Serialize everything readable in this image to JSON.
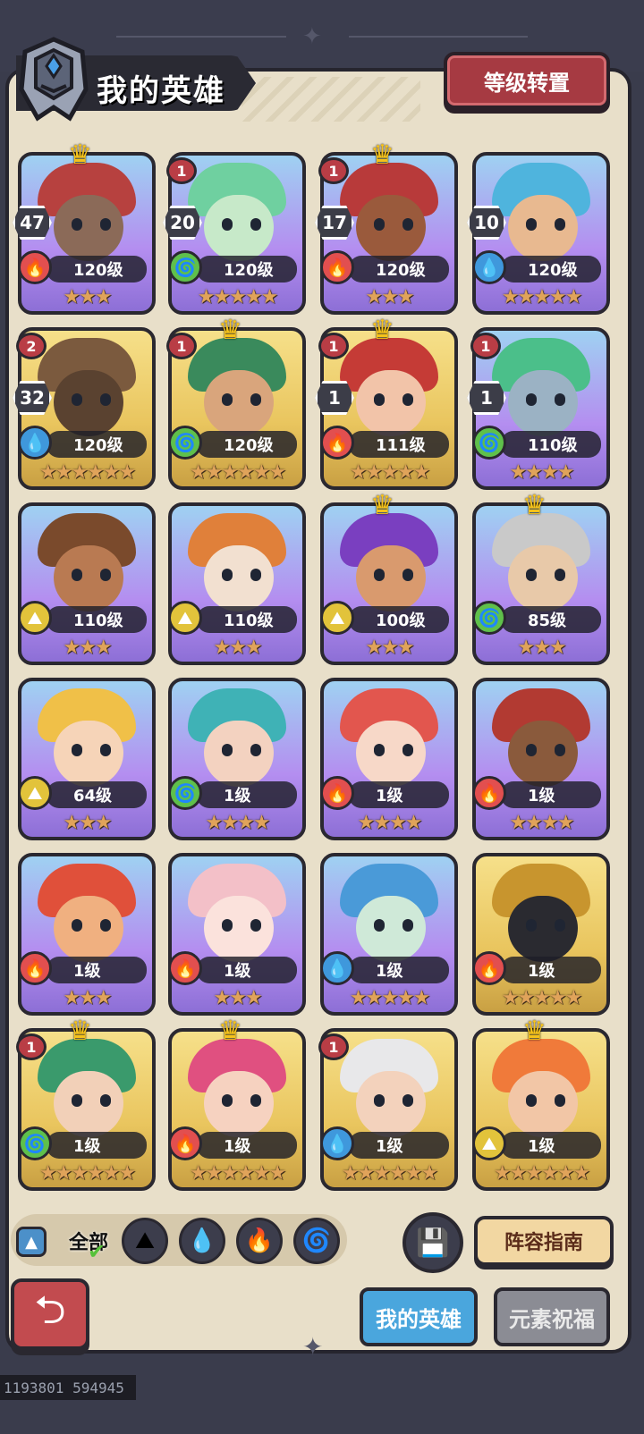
{
  "header": {
    "title": "我的英雄",
    "transfer_button": "等级转置"
  },
  "heroes": [
    {
      "level": "120级",
      "element": "fire",
      "stars": "★★★",
      "frame": "purple",
      "crown": true,
      "badge_top": "",
      "badge_count": "47",
      "hair": "#b7413f",
      "skin": "#8b6a58"
    },
    {
      "level": "120级",
      "element": "wind",
      "stars": "★★★★★",
      "frame": "purple",
      "crown": false,
      "badge_top": "1",
      "badge_count": "20",
      "hair": "#6fd0a0",
      "skin": "#c7e9c9"
    },
    {
      "level": "120级",
      "element": "fire",
      "stars": "★★★",
      "frame": "purple",
      "crown": true,
      "badge_top": "1",
      "badge_count": "17",
      "hair": "#b83a3a",
      "skin": "#9a5a3c"
    },
    {
      "level": "120级",
      "element": "water",
      "stars": "★★★★★",
      "frame": "purple",
      "crown": false,
      "badge_top": "",
      "badge_count": "10",
      "hair": "#4fb4dd",
      "skin": "#e8b990"
    },
    {
      "level": "120级",
      "element": "water",
      "stars": "★★★★★★",
      "frame": "gold",
      "crown": false,
      "badge_top": "2",
      "badge_count": "32",
      "hair": "#7b5a3e",
      "skin": "#5a4230"
    },
    {
      "level": "120级",
      "element": "wind",
      "stars": "★★★★★★",
      "frame": "gold",
      "crown": true,
      "badge_top": "1",
      "badge_count": "",
      "hair": "#3a8a5c",
      "skin": "#d9a57c"
    },
    {
      "level": "111级",
      "element": "fire",
      "stars": "★★★★★",
      "frame": "gold",
      "crown": true,
      "badge_top": "1",
      "badge_count": "1",
      "hair": "#c53b36",
      "skin": "#f2c4a9"
    },
    {
      "level": "110级",
      "element": "wind",
      "stars": "★★★★",
      "frame": "purple",
      "crown": false,
      "badge_top": "1",
      "badge_count": "1",
      "hair": "#4bbf8a",
      "skin": "#9bb2c4"
    },
    {
      "level": "110级",
      "element": "earth",
      "stars": "★★★",
      "frame": "purple",
      "crown": false,
      "badge_top": "",
      "badge_count": "",
      "hair": "#7a4a2c",
      "skin": "#b97a52"
    },
    {
      "level": "110级",
      "element": "earth",
      "stars": "★★★",
      "frame": "purple",
      "crown": false,
      "badge_top": "",
      "badge_count": "",
      "hair": "#e0803a",
      "skin": "#f2e0d0"
    },
    {
      "level": "100级",
      "element": "earth",
      "stars": "★★★",
      "frame": "purple",
      "crown": true,
      "badge_top": "",
      "badge_count": "",
      "hair": "#7a3fc0",
      "skin": "#d99a6e"
    },
    {
      "level": "85级",
      "element": "wind",
      "stars": "★★★",
      "frame": "purple",
      "crown": true,
      "badge_top": "",
      "badge_count": "",
      "hair": "#c9c9c9",
      "skin": "#e8c9a9"
    },
    {
      "level": "64级",
      "element": "earth",
      "stars": "★★★",
      "frame": "purple",
      "crown": false,
      "badge_top": "",
      "badge_count": "",
      "hair": "#f0c048",
      "skin": "#f6d4b8"
    },
    {
      "level": "1级",
      "element": "wind",
      "stars": "★★★★",
      "frame": "purple",
      "crown": false,
      "badge_top": "",
      "badge_count": "",
      "hair": "#3fb2b6",
      "skin": "#f3d2c0"
    },
    {
      "level": "1级",
      "element": "fire",
      "stars": "★★★★",
      "frame": "purple",
      "crown": false,
      "badge_top": "",
      "badge_count": "",
      "hair": "#e2564e",
      "skin": "#f7d8c8"
    },
    {
      "level": "1级",
      "element": "fire",
      "stars": "★★★★",
      "frame": "purple",
      "crown": false,
      "badge_top": "",
      "badge_count": "",
      "hair": "#b23a32",
      "skin": "#8a5a3c"
    },
    {
      "level": "1级",
      "element": "fire",
      "stars": "★★★",
      "frame": "purple",
      "crown": false,
      "badge_top": "",
      "badge_count": "",
      "hair": "#e0503a",
      "skin": "#f0b080"
    },
    {
      "level": "1级",
      "element": "fire",
      "stars": "★★★",
      "frame": "purple",
      "crown": false,
      "badge_top": "",
      "badge_count": "",
      "hair": "#f3c0c8",
      "skin": "#fbe2dc"
    },
    {
      "level": "1级",
      "element": "water",
      "stars": "★★★★★",
      "frame": "purple",
      "crown": false,
      "badge_top": "",
      "badge_count": "",
      "hair": "#4a9ad8",
      "skin": "#cfe9d8"
    },
    {
      "level": "1级",
      "element": "fire",
      "stars": "★★★★★",
      "frame": "gold",
      "crown": false,
      "badge_top": "",
      "badge_count": "",
      "hair": "#c8952e",
      "skin": "#2a2a30"
    },
    {
      "level": "1级",
      "element": "wind",
      "stars": "★★★★★★",
      "frame": "gold",
      "crown": true,
      "badge_top": "1",
      "badge_count": "",
      "hair": "#3a9a6c",
      "skin": "#f2d0b8"
    },
    {
      "level": "1级",
      "element": "fire",
      "stars": "★★★★★★",
      "frame": "gold",
      "crown": true,
      "badge_top": "",
      "badge_count": "",
      "hair": "#e05080",
      "skin": "#f6d2c0"
    },
    {
      "level": "1级",
      "element": "water",
      "stars": "★★★★★★",
      "frame": "gold",
      "crown": false,
      "badge_top": "1",
      "badge_count": "",
      "hair": "#e8e8ea",
      "skin": "#f3d2bc"
    },
    {
      "level": "1级",
      "element": "earth",
      "stars": "★★★★★★",
      "frame": "gold",
      "crown": true,
      "badge_top": "",
      "badge_count": "",
      "hair": "#f07a3a",
      "skin": "#f2c6a6"
    }
  ],
  "element_icons": {
    "fire": "🔥",
    "wind": "🌀",
    "water": "💧",
    "earth": "⛰"
  },
  "filters": {
    "all_label": "全部",
    "elements": [
      {
        "name": "earth",
        "icon": "⛰"
      },
      {
        "name": "water",
        "icon": "💧"
      },
      {
        "name": "fire",
        "icon": "🔥"
      },
      {
        "name": "wind",
        "icon": "🌀"
      }
    ]
  },
  "footer": {
    "guide_button": "阵容指南",
    "tab_my_heroes": "我的英雄",
    "tab_blessing": "元素祝福"
  },
  "debug": {
    "coords": "1193801 594945"
  }
}
